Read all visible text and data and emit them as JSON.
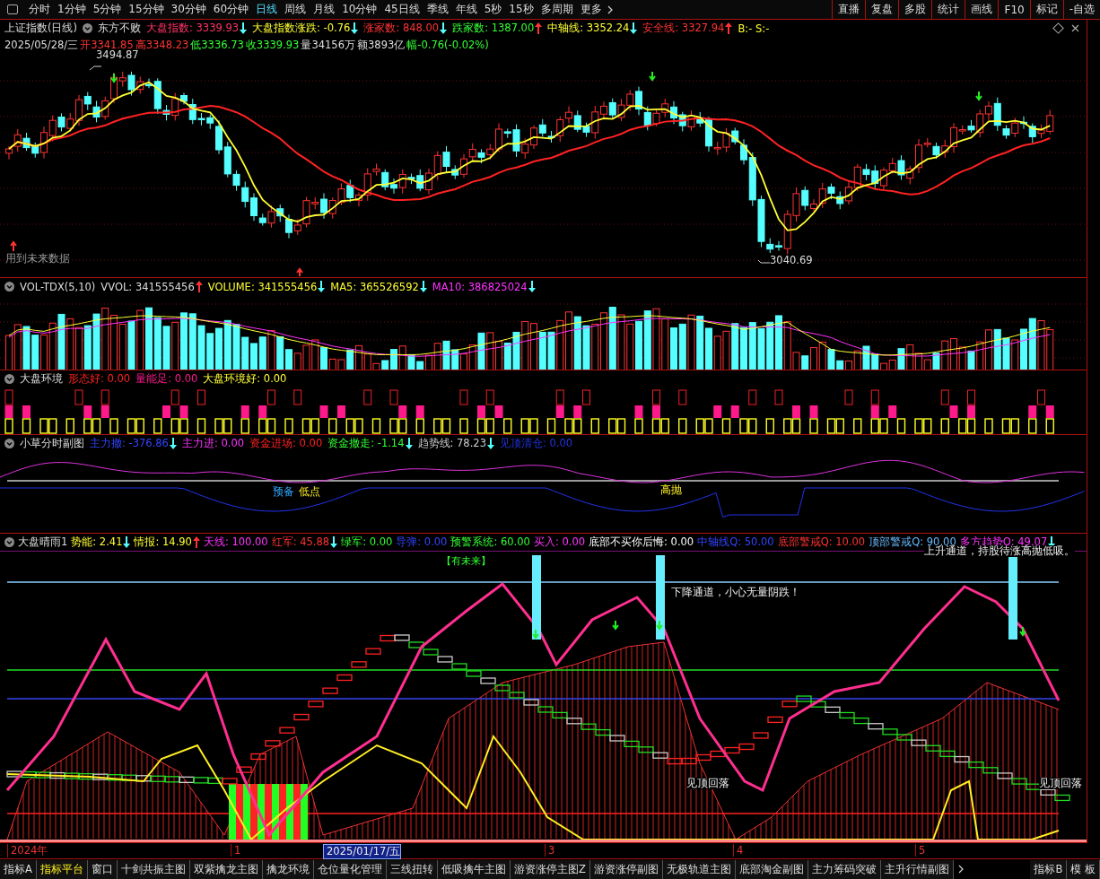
{
  "toolbar": {
    "periods": [
      {
        "label": "分时",
        "selected": false
      },
      {
        "label": "1分钟",
        "selected": false
      },
      {
        "label": "5分钟",
        "selected": false
      },
      {
        "label": "15分钟",
        "selected": false
      },
      {
        "label": "30分钟",
        "selected": false
      },
      {
        "label": "60分钟",
        "selected": false
      },
      {
        "label": "日线",
        "selected": true
      },
      {
        "label": "周线",
        "selected": false
      },
      {
        "label": "月线",
        "selected": false
      },
      {
        "label": "10分钟",
        "selected": false
      },
      {
        "label": "45日线",
        "selected": false
      },
      {
        "label": "季线",
        "selected": false
      },
      {
        "label": "年线",
        "selected": false
      },
      {
        "label": "5秒",
        "selected": false
      },
      {
        "label": "15秒",
        "selected": false
      },
      {
        "label": "多周期",
        "selected": false
      },
      {
        "label": "更多",
        "selected": false
      }
    ],
    "buttons": [
      "直播",
      "复盘",
      "多股",
      "统计",
      "画线",
      "F10",
      "标记",
      "-自选"
    ]
  },
  "main_chart": {
    "title": "上证指数(日线)",
    "formula": "东方不败",
    "legend": [
      {
        "label": "大盘指数:",
        "value": "3339.93",
        "arrow": {
          "rising": false,
          "color": "#55ffff"
        },
        "color": "#ff3366"
      },
      {
        "label": "大盘指数涨跌:",
        "value": "-0.76",
        "arrow": {
          "rising": false,
          "color": "#55ffff"
        },
        "color": "#ffff33"
      },
      {
        "label": "涨家数:",
        "value": "848.00",
        "arrow": {
          "rising": false,
          "color": "#55ffff"
        },
        "color": "#ff3333"
      },
      {
        "label": "跌家数:",
        "value": "1387.00",
        "arrow": {
          "rising": true,
          "color": "#ff3333"
        },
        "color": "#33ff33"
      },
      {
        "label": "中轴线:",
        "value": "3352.24",
        "arrow": {
          "rising": false,
          "color": "#55ffff"
        },
        "color": "#ffff33"
      },
      {
        "label": "安全线:",
        "value": "3327.94",
        "arrow": {
          "rising": true,
          "color": "#ff3333"
        },
        "color": "#ff3333"
      },
      {
        "label": "B:-",
        "value": "S:-",
        "color": "#ffff33"
      }
    ],
    "quote": [
      {
        "label": "2025/05/28/三",
        "color": "#dddddd"
      },
      {
        "label": "开3341.85",
        "color": "#ff3333"
      },
      {
        "label": "高3348.23",
        "color": "#ff3333"
      },
      {
        "label": "低3336.73",
        "color": "#33ff33"
      },
      {
        "label": "收3339.93",
        "color": "#33ff33"
      },
      {
        "label": "量34156万",
        "color": "#dddddd"
      },
      {
        "label": "额3893亿",
        "color": "#dddddd"
      },
      {
        "label": "幅-0.76(-0.02%)",
        "color": "#33ff33"
      }
    ],
    "high_label": "3494.87",
    "low_label": "3040.69",
    "note": "用到未来数据"
  },
  "volume_panel": {
    "title": "VOL-TDX(5,10)",
    "legend": [
      {
        "label": "VVOL:",
        "value": "341555456",
        "arrow": {
          "rising": true,
          "color": "#ff3333"
        },
        "color": "#dddddd"
      },
      {
        "label": "VOLUME:",
        "value": "341555456",
        "arrow": {
          "rising": false,
          "color": "#55ffff"
        },
        "color": "#ffff33"
      },
      {
        "label": "MA5:",
        "value": "365526592",
        "arrow": {
          "rising": false,
          "color": "#55ffff"
        },
        "color": "#ffff33"
      },
      {
        "label": "MA10:",
        "value": "386825024",
        "arrow": {
          "rising": false,
          "color": "#55ffff"
        },
        "color": "#ff33ff"
      }
    ]
  },
  "environment_panel": {
    "title": "大盘环境",
    "legend": [
      {
        "label": "形态好:",
        "value": "0.00",
        "color": "#ff2222"
      },
      {
        "label": "量能足:",
        "value": "0.00",
        "color": "#ff1a8c"
      },
      {
        "label": "大盘环境好:",
        "value": "0.00",
        "color": "#ffff33"
      }
    ]
  },
  "intraday_panel": {
    "title": "小草分时副图",
    "legend": [
      {
        "label": "主力撤:",
        "value": "-376.86",
        "arrow": {
          "rising": false,
          "color": "#55ffff"
        },
        "color": "#3344ff"
      },
      {
        "label": "主力进:",
        "value": "0.00",
        "color": "#ff33ff"
      },
      {
        "label": "资金进场:",
        "value": "0.00",
        "color": "#ff2222"
      },
      {
        "label": "资金撤走:",
        "value": "-1.14",
        "arrow": {
          "rising": false,
          "color": "#55ffff"
        },
        "color": "#33ff33"
      },
      {
        "label": "趋势线:",
        "value": "78.23",
        "arrow": {
          "rising": false,
          "color": "#55ffff"
        },
        "color": "#cccccc"
      },
      {
        "label": "见顶清仓:",
        "value": "0.00",
        "color": "#2233dd"
      }
    ],
    "labels": [
      "预备",
      "低点",
      "高抛"
    ]
  },
  "signal_panel": {
    "title": "大盘晴雨1",
    "legend": [
      {
        "label": "势能:",
        "value": "2.41",
        "arrow": {
          "rising": false,
          "color": "#55ffff"
        },
        "color": "#ffff33"
      },
      {
        "label": "情报:",
        "value": "14.90",
        "arrow": {
          "rising": true,
          "color": "#ff3333"
        },
        "color": "#ffff33"
      },
      {
        "label": "天线:",
        "value": "100.00",
        "color": "#ff33ff"
      },
      {
        "label": "红军:",
        "value": "45.88",
        "arrow": {
          "rising": false,
          "color": "#55ffff"
        },
        "color": "#ff3333"
      },
      {
        "label": "绿军:",
        "value": "0.00",
        "color": "#33ff33"
      },
      {
        "label": "导弹:",
        "value": "0.00",
        "color": "#3344ff"
      },
      {
        "label": "预警系统:",
        "value": "60.00",
        "color": "#33ff33"
      },
      {
        "label": "买入:",
        "value": "0.00",
        "color": "#ff33ff"
      },
      {
        "label": "底部不买你后悔:",
        "value": "0.00",
        "color": "#ffffff"
      },
      {
        "label": "中轴线Q:",
        "value": "50.00",
        "color": "#3344ff"
      },
      {
        "label": "底部警戒Q:",
        "value": "10.00",
        "color": "#ff3333"
      },
      {
        "label": "顶部警戒Q:",
        "value": "90.00",
        "color": "#66bbff"
      },
      {
        "label": "多方趋势Q:",
        "value": "49.07",
        "arrow": {
          "rising": false,
          "color": "#55ffff"
        },
        "color": "#ff33ff"
      }
    ],
    "labels": [
      "【有未来】",
      "下降通道，小心无量阴跌！",
      "上升通道，持股待涨高抛低吸。",
      "见顶回落",
      "见顶回落"
    ]
  },
  "date_axis": [
    {
      "label": "2024年",
      "selected": false
    },
    {
      "label": "1",
      "selected": false
    },
    {
      "label": "2025/01/17/五",
      "selected": true
    },
    {
      "label": "3",
      "selected": false
    },
    {
      "label": "4",
      "selected": false
    },
    {
      "label": "5",
      "selected": false
    }
  ],
  "bottom_tabs": [
    {
      "label": "指标A",
      "selected": false
    },
    {
      "label": "指标平台",
      "selected": true
    },
    {
      "label": "窗口",
      "selected": false
    },
    {
      "label": "十剑共振主图",
      "selected": false
    },
    {
      "label": "双紫擒龙主图",
      "selected": false
    },
    {
      "label": "擒龙环境",
      "selected": false
    },
    {
      "label": "仓位量化管理",
      "selected": false
    },
    {
      "label": "三线扭转",
      "selected": false
    },
    {
      "label": "低吸擒牛主图",
      "selected": false
    },
    {
      "label": "游资涨停主图Z",
      "selected": false
    },
    {
      "label": "游资涨停副图",
      "selected": false
    },
    {
      "label": "无极轨道主图",
      "selected": false
    },
    {
      "label": "底部淘金副图",
      "selected": false
    },
    {
      "label": "主力筹码突破",
      "selected": false
    },
    {
      "label": "主升行情副图",
      "selected": false
    }
  ],
  "bottom_right_tabs": [
    "指标B",
    "模 板"
  ]
}
